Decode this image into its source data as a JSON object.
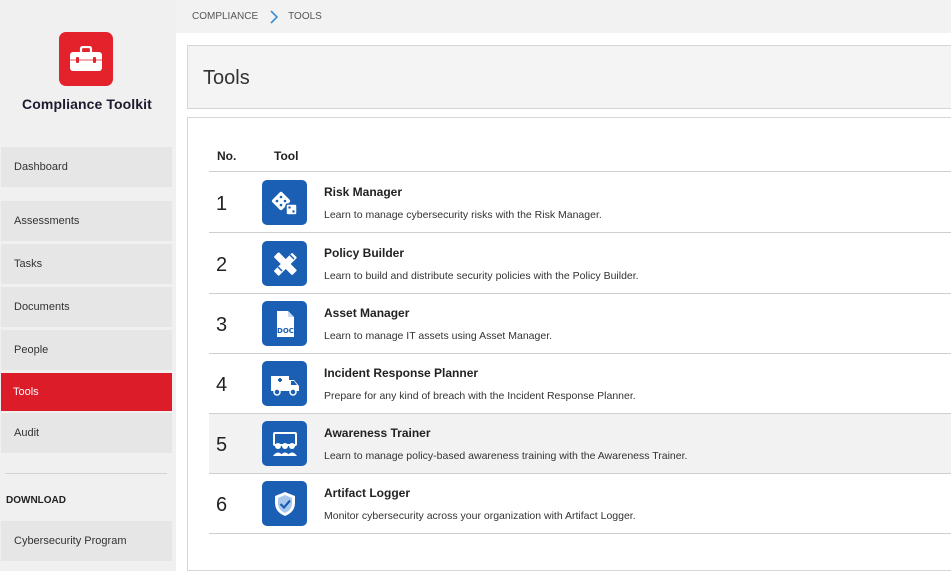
{
  "app": {
    "title": "Compliance Toolkit"
  },
  "breadcrumb": {
    "root": "COMPLIANCE",
    "current": "TOOLS"
  },
  "sidebar": {
    "items": [
      {
        "label": "Dashboard",
        "active": false
      },
      {
        "label": "Assessments",
        "active": false
      },
      {
        "label": "Tasks",
        "active": false
      },
      {
        "label": "Documents",
        "active": false
      },
      {
        "label": "People",
        "active": false
      },
      {
        "label": "Tools",
        "active": true
      },
      {
        "label": "Audit",
        "active": false
      }
    ],
    "download_label": "DOWNLOAD",
    "download_items": [
      {
        "label": "Cybersecurity Program"
      }
    ]
  },
  "page": {
    "title": "Tools"
  },
  "table": {
    "headers": {
      "no": "No.",
      "tool": "Tool"
    },
    "rows": [
      {
        "no": "1",
        "name": "Risk Manager",
        "desc": "Learn to manage cybersecurity risks with the Risk Manager.",
        "icon": "dice-icon"
      },
      {
        "no": "2",
        "name": "Policy Builder",
        "desc": "Learn to build and distribute security policies with the Policy Builder.",
        "icon": "pencil-ruler-icon"
      },
      {
        "no": "3",
        "name": "Asset Manager",
        "desc": "Learn to manage IT assets using Asset Manager.",
        "icon": "doc-file-icon"
      },
      {
        "no": "4",
        "name": "Incident Response Planner",
        "desc": "Prepare for any kind of breach with the Incident Response Planner.",
        "icon": "ambulance-icon"
      },
      {
        "no": "5",
        "name": "Awareness Trainer",
        "desc": "Learn to manage policy-based awareness training with the Awareness Trainer.",
        "icon": "group-training-icon"
      },
      {
        "no": "6",
        "name": "Artifact Logger",
        "desc": "Monitor cybersecurity across your organization with Artifact Logger.",
        "icon": "shield-check-icon"
      }
    ]
  },
  "colors": {
    "accent_red": "#dc1c28",
    "icon_blue": "#1a5fb4",
    "breadcrumb_chevron": "#3a8fd6"
  }
}
